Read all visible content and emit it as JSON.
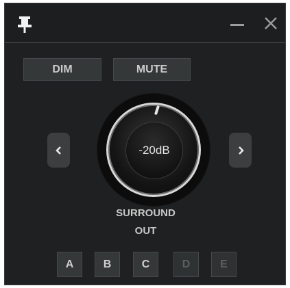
{
  "titlebar": {
    "pin_icon": "pin-icon",
    "minimize_icon": "minimize-icon",
    "close_icon": "close-icon"
  },
  "buttons": {
    "dim": "DIM",
    "mute": "MUTE"
  },
  "knob": {
    "value": "-20dB"
  },
  "navigation": {
    "prev_icon": "chevron-left-icon",
    "next_icon": "chevron-right-icon"
  },
  "output": {
    "label_line1": "SURROUND",
    "label_line2": "OUT"
  },
  "selectors": [
    {
      "label": "A",
      "enabled": true
    },
    {
      "label": "B",
      "enabled": true
    },
    {
      "label": "C",
      "enabled": true
    },
    {
      "label": "D",
      "enabled": false
    },
    {
      "label": "E",
      "enabled": false
    }
  ],
  "colors": {
    "background": "#1f2021",
    "button": "#353839",
    "text": "#c9cbcc",
    "disabled_text": "#5c5f61"
  }
}
